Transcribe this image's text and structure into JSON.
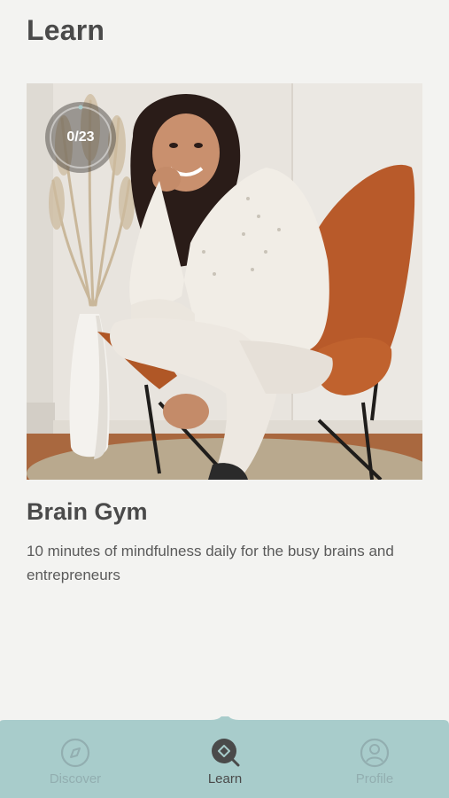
{
  "header": {
    "title": "Learn"
  },
  "course": {
    "progress_label": "0/23",
    "progress_completed": 0,
    "progress_total": 23,
    "title": "Brain Gym",
    "description": "10 minutes of mindfulness daily for the busy brains and entrepreneurs"
  },
  "tabs": [
    {
      "label": "Discover",
      "icon": "compass-icon",
      "active": false
    },
    {
      "label": "Learn",
      "icon": "learn-search-icon",
      "active": true
    },
    {
      "label": "Profile",
      "icon": "user-icon",
      "active": false
    }
  ],
  "colors": {
    "background": "#f3f3f1",
    "tab_bar": "#a8cccb",
    "text_primary": "#4a4a4a",
    "tab_inactive": "#92aeb0"
  }
}
